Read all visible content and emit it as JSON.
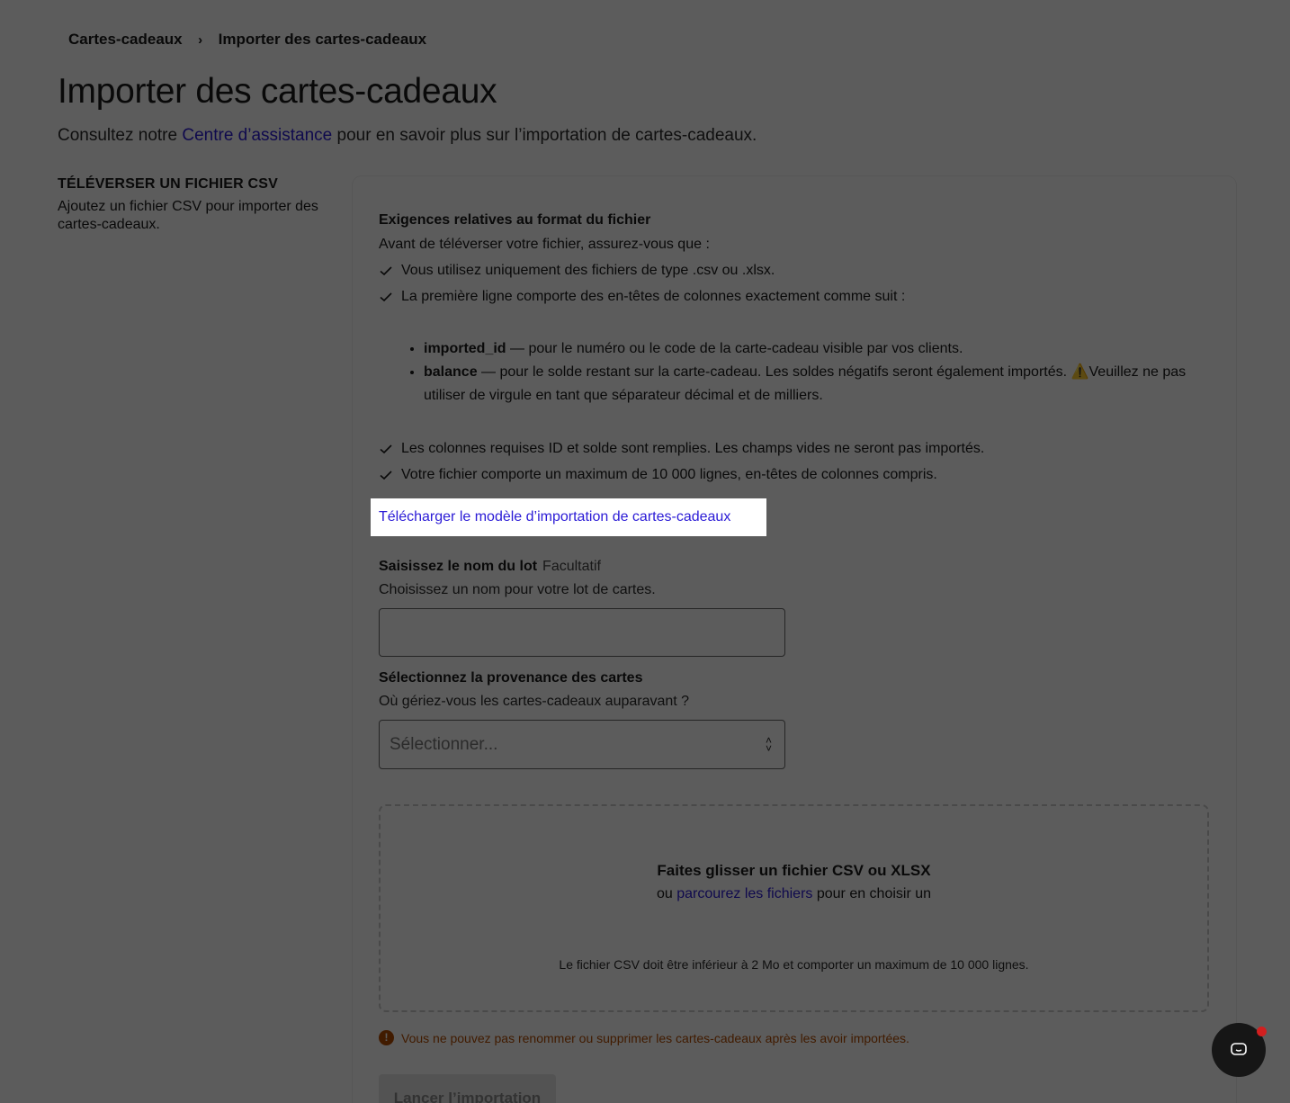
{
  "breadcrumb": {
    "parent": "Cartes-cadeaux",
    "current": "Importer des cartes-cadeaux"
  },
  "page": {
    "title": "Importer des cartes-cadeaux",
    "subtitle_prefix": "Consultez notre",
    "subtitle_link": "Centre d’assistance",
    "subtitle_suffix": "pour en savoir plus sur l’importation de cartes-cadeaux."
  },
  "section": {
    "heading": "TÉLÉVERSER UN FICHIER CSV",
    "description": "Ajoutez un fichier CSV pour importer des cartes-cadeaux."
  },
  "requirements": {
    "title": "Exigences relatives au format du fichier",
    "intro": "Avant de téléverser votre fichier, assurez-vous que :",
    "checks_top": [
      "Vous utilisez uniquement des fichiers de type .csv ou .xlsx.",
      "La première ligne comporte des en-têtes de colonnes exactement comme suit :"
    ],
    "columns": [
      {
        "name": "imported_id",
        "text": " — pour le numéro ou le code de la carte-cadeau visible par vos clients."
      },
      {
        "name": "balance",
        "text": " — pour le solde restant sur la carte-cadeau. Les soldes négatifs seront également importés.",
        "warning": "Veuillez ne pas utiliser de virgule en tant que séparateur décimal et de milliers."
      }
    ],
    "checks_bottom": [
      "Les colonnes requises ID et solde sont remplies. Les champs vides ne seront pas importés.",
      "Votre fichier comporte un maximum de 10 000 lignes, en-têtes de colonnes compris."
    ]
  },
  "download_link": "Télécharger le modèle d’importation de cartes-cadeaux",
  "batch": {
    "label": "Saisissez le nom du lot",
    "optional": "Facultatif",
    "help": "Choisissez un nom pour votre lot de cartes.",
    "value": ""
  },
  "source": {
    "label": "Sélectionnez la provenance des cartes",
    "help": "Où gériez-vous les cartes-cadeaux auparavant ?",
    "placeholder": "Sélectionner..."
  },
  "dropzone": {
    "title": "Faites glisser un fichier CSV ou XLSX",
    "sub_prefix": "ou",
    "sub_link": "parcourez les fichiers",
    "sub_suffix": "pour en choisir un",
    "note": "Le fichier CSV doit être inférieur à 2 Mo et comporter un maximum de 10 000 lignes."
  },
  "alert": "Vous ne pouvez pas renommer ou supprimer les cartes-cadeaux après les avoir importées.",
  "launch_button": "Lancer l’importation",
  "colors": {
    "link": "#2b1bd6",
    "warning": "#b44b00",
    "overlay": "rgba(0,0,0,0.64)",
    "chat": "#161616",
    "notification": "#d21f1f"
  },
  "icons": {
    "breadcrumb_separator": "chevron-right-icon",
    "check": "check-icon",
    "warning": "warning-icon",
    "alert": "exclamation-circle-icon",
    "select": "up-down-chevron-icon",
    "chat": "chat-icon"
  }
}
